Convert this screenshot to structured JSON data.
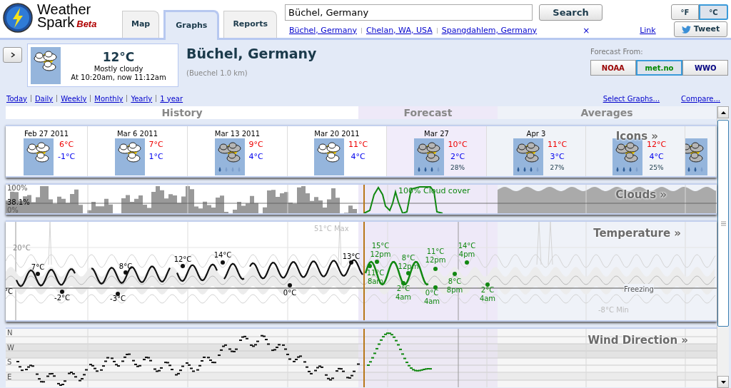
{
  "header": {
    "logo": {
      "line1": "Weather",
      "line2": "Spark",
      "badge": "Beta"
    },
    "tabs": [
      {
        "label": "Map",
        "selected": false
      },
      {
        "label": "Graphs",
        "selected": true
      },
      {
        "label": "Reports",
        "selected": false
      }
    ],
    "search": {
      "value": "Büchel, Germany",
      "button": "Search"
    },
    "recent_places": [
      "Büchel, Germany",
      "Chelan, WA, USA",
      "Spangdahlem, Germany"
    ],
    "clear": "×",
    "link": "Link",
    "units": [
      {
        "label": "°F",
        "selected": false
      },
      {
        "label": "°C",
        "selected": true
      }
    ],
    "tweet": "Tweet"
  },
  "current": {
    "temperature": "12°C",
    "condition": "Mostly cloudy",
    "time": "At 10:20am, now 11:12am"
  },
  "location": {
    "title": "Büchel, Germany",
    "station": "(Buechel 1.0 km)"
  },
  "forecast_source": {
    "label": "Forecast From:",
    "options": [
      {
        "label": "NOAA",
        "selected": false,
        "color": "#990000"
      },
      {
        "label": "met.no",
        "selected": true,
        "color": "#008800"
      },
      {
        "label": "WWO",
        "selected": false,
        "color": "#000080"
      }
    ]
  },
  "views": [
    "Today",
    "Daily",
    "Weekly",
    "Monthly",
    "Yearly",
    "1 year"
  ],
  "actions": [
    "Select Graphs...",
    "Compare..."
  ],
  "periods": [
    {
      "label": "History",
      "kind": "history"
    },
    {
      "label": "Forecast",
      "kind": "forecast"
    },
    {
      "label": "Averages",
      "kind": "average"
    }
  ],
  "icons_panel": {
    "title": "Icons »",
    "weeks": [
      {
        "kind": "partly_cloudy",
        "date": "Feb 27 2011",
        "high": "6°C",
        "low": "-1°C"
      },
      {
        "kind": "partly_cloudy",
        "date": "Mar 6 2011",
        "high": "7°C",
        "low": "1°C"
      },
      {
        "kind": "light_rain",
        "date": "Mar 13 2011",
        "high": "9°C",
        "low": "4°C"
      },
      {
        "kind": "partly_cloudy",
        "date": "Mar 20 2011",
        "high": "11°C",
        "low": "4°C"
      },
      {
        "kind": "rain",
        "date": "Mar 27",
        "high": "10°C",
        "low": "2°C",
        "chance": "28%"
      },
      {
        "kind": "rain",
        "date": "Apr 3",
        "high": "11°C",
        "low": "3°C",
        "chance": "27%"
      },
      {
        "kind": "rain",
        "high": "12°C",
        "low": "4°C",
        "chance": "25%"
      },
      {
        "kind": "rain"
      }
    ]
  },
  "clouds_panel": {
    "title": "Clouds »",
    "axis": [
      "100%",
      "38.1%",
      "0%"
    ],
    "note": "100% Cloud cover"
  },
  "temperature_panel": {
    "title": "Temperature »",
    "max": "51°C Max",
    "axis": "20°C",
    "freezing": "Freezing",
    "min": "-8°C Min",
    "labels": [
      {
        "kind": "history",
        "value": "°C"
      },
      {
        "kind": "history",
        "value": "7°C"
      },
      {
        "kind": "history",
        "value": "-2°C"
      },
      {
        "kind": "history",
        "value": "8°C"
      },
      {
        "kind": "history",
        "value": "-3°C"
      },
      {
        "kind": "history",
        "value": "12°C"
      },
      {
        "kind": "history",
        "value": "14°C"
      },
      {
        "kind": "history",
        "value": "0°C"
      },
      {
        "kind": "history",
        "value": "13°C"
      },
      {
        "kind": "forecast",
        "value": "15°C",
        "time": "12pm"
      },
      {
        "kind": "forecast",
        "value": "11°C",
        "time": "8am"
      },
      {
        "kind": "forecast",
        "value": "8°C",
        "time": "12pm"
      },
      {
        "kind": "forecast",
        "value": "2°C",
        "time": "4am"
      },
      {
        "kind": "forecast",
        "value": "11°C",
        "time": "12pm"
      },
      {
        "kind": "forecast",
        "value": "0°C",
        "time": "4am"
      },
      {
        "kind": "forecast",
        "value": "8°C",
        "time": "8pm"
      },
      {
        "kind": "forecast",
        "value": "14°C",
        "time": "4pm"
      },
      {
        "kind": "forecast",
        "value": "2°C",
        "time": "4am"
      }
    ]
  },
  "wind_panel": {
    "title": "Wind Direction »",
    "axis": [
      "N",
      "W",
      "S",
      "E"
    ]
  }
}
